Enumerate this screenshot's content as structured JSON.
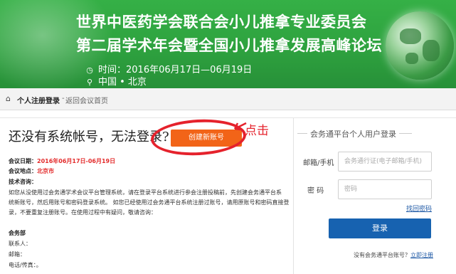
{
  "banner": {
    "title_line1": "世界中医药学会联合会小儿推拿专业委员会",
    "title_line2": "第二届学术年会暨全国小儿推拿发展高峰论坛",
    "date_text": "时间：2016年06月17日—06月19日",
    "location_text": "中国 • 北京"
  },
  "breadcrumb": {
    "title": "个人注册登录",
    "separator": "-",
    "back_link": "返回会议首页"
  },
  "left": {
    "no_account_text": "还没有系统帐号，无法登录?",
    "create_button": "创建新账号",
    "annotation_click": "点击",
    "meeting_date_label": "会议日期：",
    "meeting_date_value": "2016年06月17日-06月19日",
    "meeting_place_label": "会议地点：",
    "meeting_place_value": "北京市",
    "tech_support_label": "技术咨询：",
    "help_line1": "如您从没使用过会务通学术会议平台管理系统，请在登录平台系统进行参会注册投稿前，先创建会务通平台系",
    "help_line2": "统新账号，然后用账号和密码登录系统。  如您已经使用过会务通平台系统注册过账号，请用原账号和密码直接登",
    "help_line3": "录，不要重复注册账号。在使用过程中有疑问，敬请咨询：",
    "office_label": "会务部",
    "contact_label": "联系人：",
    "email_label": "邮箱：",
    "phone_label": "电话/传真：。"
  },
  "login": {
    "panel_title": "会务通平台个人用户登录",
    "account_label": "邮箱/手机",
    "account_placeholder": "会务通行证(电子邮箱/手机)",
    "password_label": "密    码",
    "password_placeholder": "密码",
    "forgot_link": "找回密码",
    "login_button": "登录",
    "no_account_prompt": "没有会务通平台账号？",
    "register_link": "立即注册"
  },
  "colors": {
    "banner_green": "#2ea23f",
    "create_button_orange": "#f26418",
    "login_button_blue": "#1762b0",
    "annotation_red": "#e5222c"
  }
}
